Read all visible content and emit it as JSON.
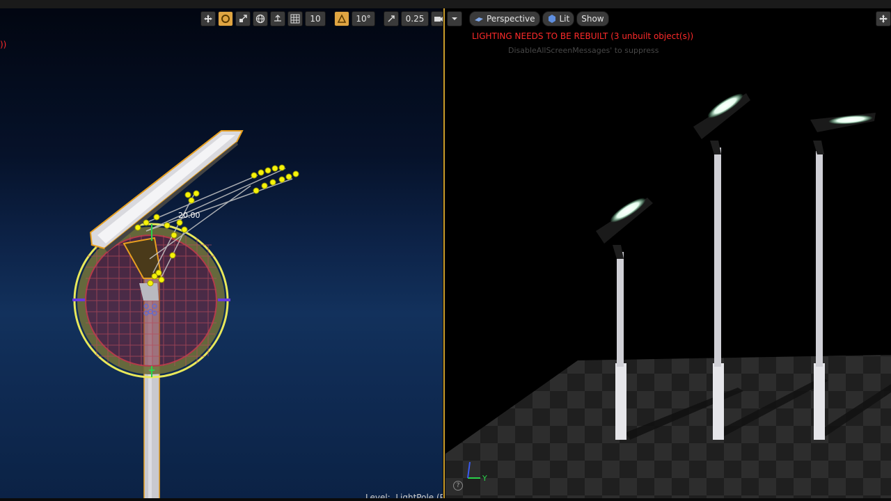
{
  "left_viewport": {
    "toolbar": {
      "grid_snap_value": "10",
      "rotation_snap_value": "10°",
      "scale_snap_value": "0.25"
    },
    "status_text_fragment": "))",
    "gizmo_value": "20.00",
    "level_label": "Level:",
    "level_name": "LightPole (Pe"
  },
  "right_viewport": {
    "toolbar": {
      "view_mode_label": "Perspective",
      "lit_label": "Lit",
      "show_label": "Show"
    },
    "warning_text": "LIGHTING NEEDS TO BE REBUILT (3 unbuilt object(s))",
    "hint_text": "DisableAllScreenMessages' to suppress",
    "axis_label": "Y"
  },
  "colors": {
    "selection_outline": "#f0a020",
    "gizmo_ring": "#e8e85a",
    "warning": "#ff2a2a",
    "active_button": "#e0a542"
  }
}
